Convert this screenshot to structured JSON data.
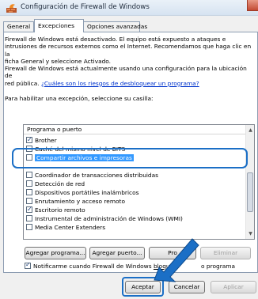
{
  "window": {
    "title": "Configuración de Firewall de Windows"
  },
  "tabs": [
    {
      "label": "General"
    },
    {
      "label": "Excepciones"
    },
    {
      "label": "Opciones avanzadas"
    }
  ],
  "info": {
    "line1": "Firewall de Windows está desactivado. El equipo está expuesto a ataques e",
    "line2": "intrusiones de recursos externos como el Internet. Recomendamos que haga clic en la",
    "line3": "ficha General y seleccione Activado.",
    "line4": "Firewall de Windows está actualmente usando una configuración para la ubicación de",
    "line5_prefix": "red pública.",
    "line5_link": "¿Cuáles son los riesgos de desbloquear un programa?",
    "instruction": "Para habilitar una excepción, seleccione su casilla:"
  },
  "list": {
    "header": "Programa o puerto",
    "items": [
      {
        "label": "Brother",
        "checked": true
      },
      {
        "label": "Caché del mismo nivel de BITS",
        "checked": false
      },
      {
        "label": "Compartir archivos e impresoras",
        "checked": false,
        "selected": true
      },
      {
        "label": "Coordinador de transacciones distribuidas",
        "checked": false
      },
      {
        "label": "Detección de red",
        "checked": false
      },
      {
        "label": "Dispositivos portátiles inalámbricos",
        "checked": false
      },
      {
        "label": "Enrutamiento y acceso remoto",
        "checked": false
      },
      {
        "label": "Escritorio remoto",
        "checked": true
      },
      {
        "label": "Instrumental de administración de Windows (WMI)",
        "checked": false
      },
      {
        "label": "Media Center Extenders",
        "checked": false
      }
    ]
  },
  "buttons": {
    "add_program": "Agregar programa...",
    "add_port": "Agregar puerto...",
    "properties": "Pro",
    "delete": "Eliminar",
    "accept": "Aceptar",
    "cancel": "Cancelar",
    "apply": "Aplicar"
  },
  "notify": {
    "text_before": "Notificarme cuando Firewall de Windows",
    "text_underlined": "bloquee",
    "text_after": "o programa",
    "checked": true
  },
  "colors": {
    "accent": "#1b6fc6",
    "selection": "#3399ff",
    "link": "#0033cc"
  }
}
